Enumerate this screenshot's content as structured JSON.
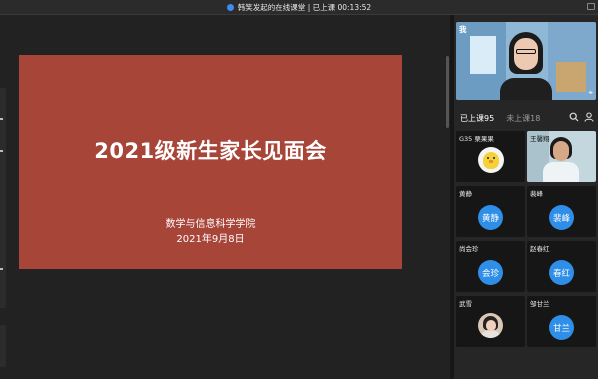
{
  "titlebar": {
    "title": "韩笑发起的在线课堂 | 已上课 00:13:52"
  },
  "slide": {
    "title": "2021级新生家长见面会",
    "subtitle": "数学与信息科学学院",
    "date": "2021年9月8日",
    "background": "#a74539"
  },
  "self_video": {
    "label": "我"
  },
  "tabs": {
    "joined": "已上课95",
    "not_joined": "未上课18"
  },
  "participants": [
    {
      "name": "G35 栗果果",
      "avatar": ""
    },
    {
      "name": "王馨翔",
      "avatar": ""
    },
    {
      "name": "黄静",
      "avatar": "黄静"
    },
    {
      "name": "裴峰",
      "avatar": "裴峰"
    },
    {
      "name": "尚会珍",
      "avatar": "会珍"
    },
    {
      "name": "赵春红",
      "avatar": "春红"
    },
    {
      "name": "武雪",
      "avatar": ""
    },
    {
      "name": "邹甘兰",
      "avatar": "甘兰"
    }
  ],
  "colors": {
    "accent": "#2f8ee8",
    "panel": "#262626",
    "stage": "#222222"
  }
}
